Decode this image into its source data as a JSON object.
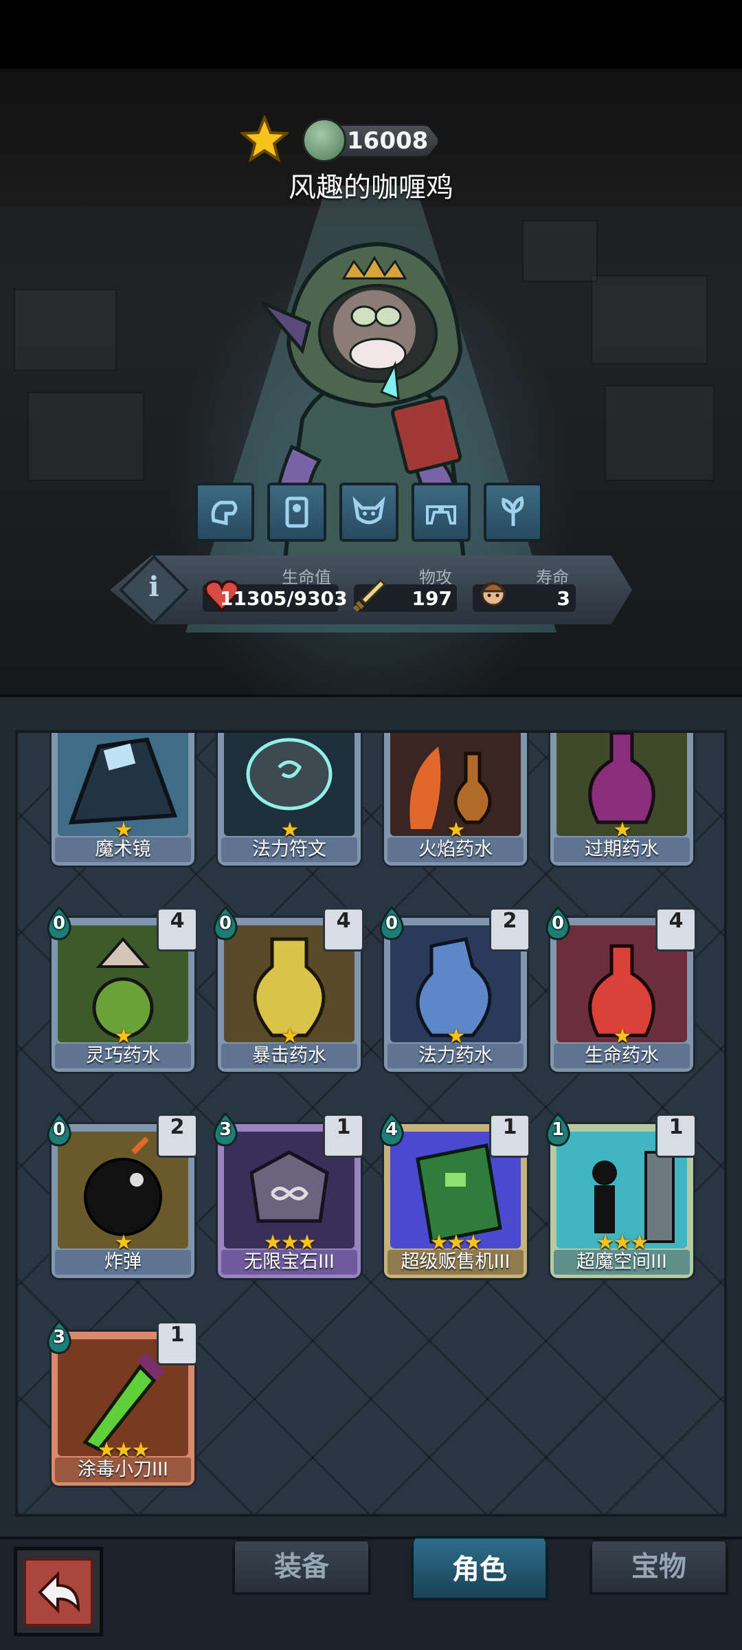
{
  "header": {
    "score": "16008",
    "hero_name": "风趣的咖喱鸡"
  },
  "skills": [
    "fist-rune-icon",
    "armor-rune-icon",
    "beast-rune-icon",
    "guns-rune-icon",
    "flower-rune-icon"
  ],
  "stats": {
    "hp_label": "生命值",
    "hp_value": "11305/9303",
    "atk_label": "物攻",
    "atk_value": "197",
    "life_label": "寿命",
    "life_value": "3"
  },
  "inventory": {
    "row0": [
      {
        "name": "魔术镜",
        "stars": "★"
      },
      {
        "name": "法力符文",
        "stars": "★"
      },
      {
        "name": "火焰药水",
        "stars": "★"
      },
      {
        "name": "过期药水",
        "stars": "★"
      }
    ],
    "row1": [
      {
        "name": "灵巧药水",
        "stars": "★",
        "cost": "0",
        "count": "4"
      },
      {
        "name": "暴击药水",
        "stars": "★",
        "cost": "0",
        "count": "4"
      },
      {
        "name": "法力药水",
        "stars": "★",
        "cost": "0",
        "count": "2"
      },
      {
        "name": "生命药水",
        "stars": "★",
        "cost": "0",
        "count": "4"
      }
    ],
    "row2": [
      {
        "name": "炸弹",
        "stars": "★",
        "cost": "0",
        "count": "2"
      },
      {
        "name": "无限宝石III",
        "stars": "★★★",
        "cost": "3",
        "count": "1"
      },
      {
        "name": "超级贩售机III",
        "stars": "★★★",
        "cost": "4",
        "count": "1"
      },
      {
        "name": "超魔空间III",
        "stars": "★★★",
        "cost": "1",
        "count": "1"
      }
    ],
    "row3": [
      {
        "name": "涂毒小刀III",
        "stars": "★★★",
        "cost": "3",
        "count": "1"
      }
    ]
  },
  "nav": {
    "tab_equip": "装备",
    "tab_role": "角色",
    "tab_treasure": "宝物",
    "active": "角色"
  },
  "colors": {
    "accent": "#2d6d8b",
    "star": "#f6c21c",
    "back_button": "#a9463d"
  }
}
